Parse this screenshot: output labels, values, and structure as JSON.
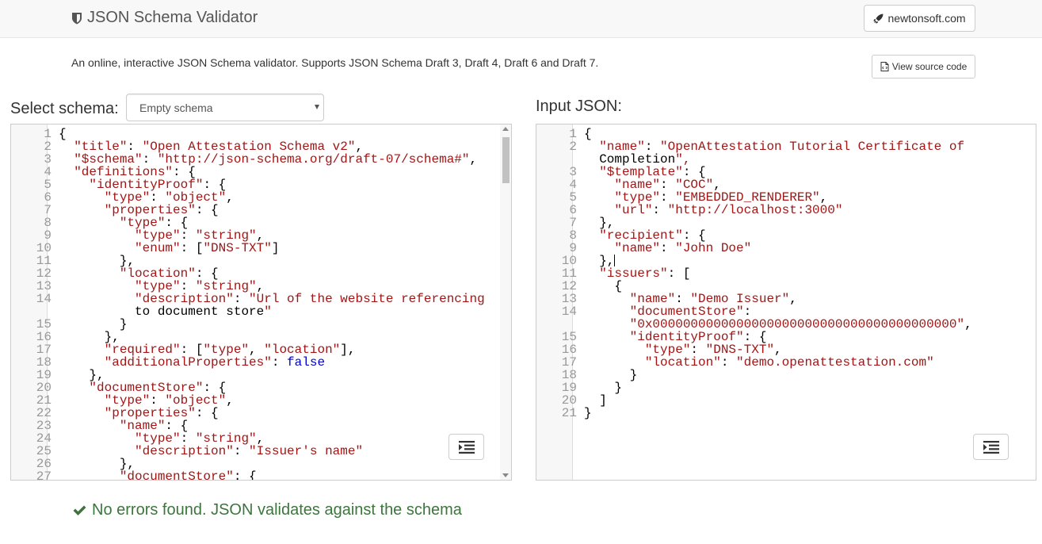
{
  "header": {
    "title": "JSON Schema Validator",
    "link_label": "newtonsoft.com"
  },
  "intro": {
    "text": "An online, interactive JSON Schema validator. Supports JSON Schema Draft 3, Draft 4, Draft 6 and Draft 7.",
    "source_button": "View source code"
  },
  "schema_panel": {
    "label": "Select schema:",
    "selected_option": "Empty schema",
    "lines": [
      "{",
      "  \"title\": \"Open Attestation Schema v2\",",
      "  \"$schema\": \"http://json-schema.org/draft-07/schema#\",",
      "  \"definitions\": {",
      "    \"identityProof\": {",
      "      \"type\": \"object\",",
      "      \"properties\": {",
      "        \"type\": {",
      "          \"type\": \"string\",",
      "          \"enum\": [\"DNS-TXT\"]",
      "        },",
      "        \"location\": {",
      "          \"type\": \"string\",",
      "          \"description\": \"Url of the website referencing",
      "          to document store\"",
      "        }",
      "      },",
      "      \"required\": [\"type\", \"location\"],",
      "      \"additionalProperties\": false",
      "    },",
      "    \"documentStore\": {",
      "      \"type\": \"object\",",
      "      \"properties\": {",
      "        \"name\": {",
      "          \"type\": \"string\",",
      "          \"description\": \"Issuer's name\"",
      "        },",
      "        \"documentStore\": {"
    ],
    "line_numbers": [
      "1",
      "2",
      "3",
      "4",
      "5",
      "6",
      "7",
      "8",
      "9",
      "10",
      "11",
      "12",
      "13",
      "14",
      "",
      "15",
      "16",
      "17",
      "18",
      "19",
      "20",
      "21",
      "22",
      "23",
      "24",
      "25",
      "26",
      "27"
    ]
  },
  "json_panel": {
    "label": "Input JSON:",
    "lines": [
      "{",
      "  \"name\": \"OpenAttestation Tutorial Certificate of",
      "  Completion\",",
      "  \"$template\": {",
      "    \"name\": \"COC\",",
      "    \"type\": \"EMBEDDED_RENDERER\",",
      "    \"url\": \"http://localhost:3000\"",
      "  },",
      "  \"recipient\": {",
      "    \"name\": \"John Doe\"",
      "  },",
      "  \"issuers\": [",
      "    {",
      "      \"name\": \"Demo Issuer\",",
      "      \"documentStore\":",
      "      \"0x0000000000000000000000000000000000000000\",",
      "      \"identityProof\": {",
      "        \"type\": \"DNS-TXT\",",
      "        \"location\": \"demo.openattestation.com\"",
      "      }",
      "    }",
      "  ]",
      "}"
    ],
    "line_numbers": [
      "1",
      "2",
      "",
      "3",
      "4",
      "5",
      "6",
      "7",
      "8",
      "9",
      "10",
      "11",
      "12",
      "13",
      "14",
      "",
      "15",
      "16",
      "17",
      "18",
      "19",
      "20",
      "21"
    ]
  },
  "status": {
    "message": "No errors found. JSON validates against the schema",
    "color": "#3c763d"
  },
  "icons": {
    "brand": "shield-icon",
    "nav": "rocket-icon",
    "source": "file-code-icon",
    "format": "indent-icon",
    "status": "check-icon"
  }
}
